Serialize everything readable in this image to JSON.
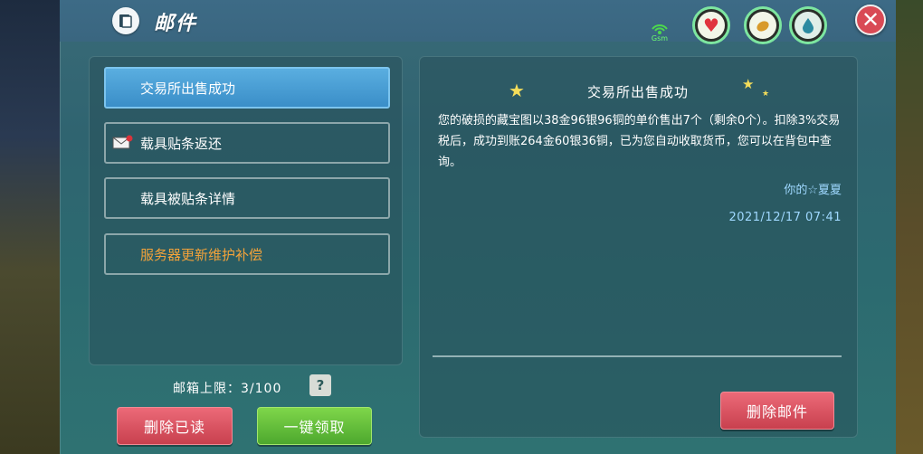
{
  "window": {
    "title": "邮件"
  },
  "status": {
    "signal_label": "Gsm",
    "stats": [
      {
        "name": "health",
        "icon": "heart-icon",
        "color": "#e0343e"
      },
      {
        "name": "hunger",
        "icon": "food-icon",
        "color": "#d89a2a"
      },
      {
        "name": "thirst",
        "icon": "water-drop-icon",
        "color": "#2b8aa0"
      }
    ]
  },
  "mail_list": {
    "items": [
      {
        "label": "交易所出售成功",
        "active": true
      },
      {
        "label": "载具贴条返还",
        "has_icon": true
      },
      {
        "label": "载具被贴条详情"
      },
      {
        "label": "服务器更新维护补偿",
        "color": "#f2a23a"
      }
    ],
    "capacity_label": "邮箱上限：3/100",
    "help_label": "?",
    "delete_read_label": "删除已读",
    "claim_all_label": "一键领取"
  },
  "mail_detail": {
    "title": "交易所出售成功",
    "body": "您的破损的藏宝图以38金96银96铜的单价售出7个（剩余0个）。扣除3%交易税后，成功到账264金60银36铜，已为您自动收取货币，您可以在背包中查询。",
    "sender": "你的☆夏夏",
    "date": "2021/12/17 07:41",
    "delete_label": "删除邮件"
  },
  "colors": {
    "accent_blue": "#3a8ec8",
    "button_red": "#c8404e",
    "button_green": "#4da82e",
    "highlight_orange": "#f2a23a"
  }
}
